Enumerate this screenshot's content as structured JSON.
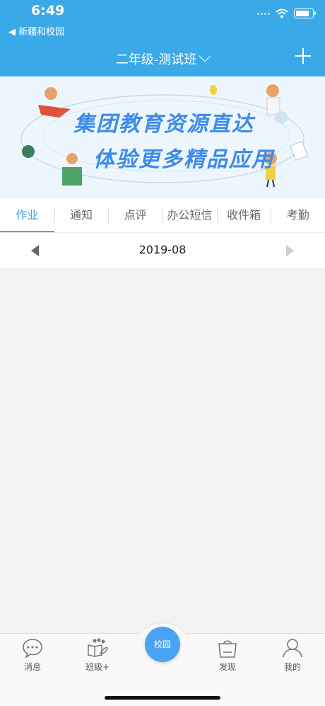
{
  "status_bar": {
    "time": "6:49",
    "back_app": "◀ 新疆和校园"
  },
  "nav": {
    "title": "二年级-测试班"
  },
  "banner": {
    "line1": "集团教育资源直达",
    "line2": "体验更多精品应用"
  },
  "tabs": [
    "作业",
    "通知",
    "点评",
    "办公短信",
    "收件箱",
    "考勤"
  ],
  "active_tab": "作业",
  "date_selector": {
    "value": "2019-08"
  },
  "tab_bar": {
    "items": [
      "消息",
      "班级+",
      "发现",
      "我的"
    ],
    "center": "校园"
  },
  "colors": {
    "accent": "#3aa9e8",
    "center_button": "#4aa3f2",
    "background": "#f2f2f2"
  },
  "icons": [
    "wifi-icon",
    "battery-icon",
    "chevron-down-icon",
    "plus-icon",
    "arrow-left-icon",
    "arrow-right-icon",
    "message-icon",
    "class-icon",
    "discover-bag-icon",
    "profile-icon"
  ]
}
